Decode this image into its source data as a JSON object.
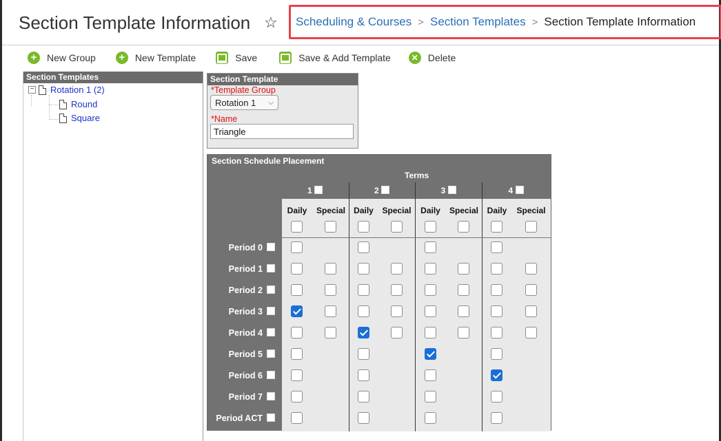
{
  "header": {
    "title": "Section Template Information",
    "breadcrumb": [
      "Scheduling & Courses",
      "Section Templates",
      "Section Template Information"
    ]
  },
  "toolbar": {
    "new_group": "New Group",
    "new_template": "New Template",
    "save": "Save",
    "save_add": "Save & Add Template",
    "delete": "Delete"
  },
  "tree": {
    "title": "Section Templates",
    "group": "Rotation 1 (2)",
    "children": [
      "Round",
      "Square"
    ]
  },
  "section_template": {
    "title": "Section Template",
    "group_label": "*Template Group",
    "group_value": "Rotation 1",
    "name_label": "*Name",
    "name_value": "Triangle"
  },
  "placement": {
    "title": "Section Schedule Placement",
    "terms_label": "Terms",
    "terms": [
      "1",
      "2",
      "3",
      "4"
    ],
    "col_daily": "Daily",
    "col_special": "Special",
    "periods": [
      "Period 0",
      "Period 1",
      "Period 2",
      "Period 3",
      "Period 4",
      "Period 5",
      "Period 6",
      "Period 7",
      "Period ACT"
    ],
    "special_periods": [
      "Period 1",
      "Period 2",
      "Period 3",
      "Period 4"
    ],
    "checked": [
      {
        "period": "Period 3",
        "term": "1"
      },
      {
        "period": "Period 4",
        "term": "2"
      },
      {
        "period": "Period 5",
        "term": "3"
      },
      {
        "period": "Period 6",
        "term": "4"
      }
    ]
  },
  "colors": {
    "accent_green": "#7ab929",
    "breadcrumb_highlight": "#e8424b",
    "link_blue": "#2a6fb5",
    "panel_gray": "#727272",
    "checkbox_blue": "#1a6fd6"
  }
}
